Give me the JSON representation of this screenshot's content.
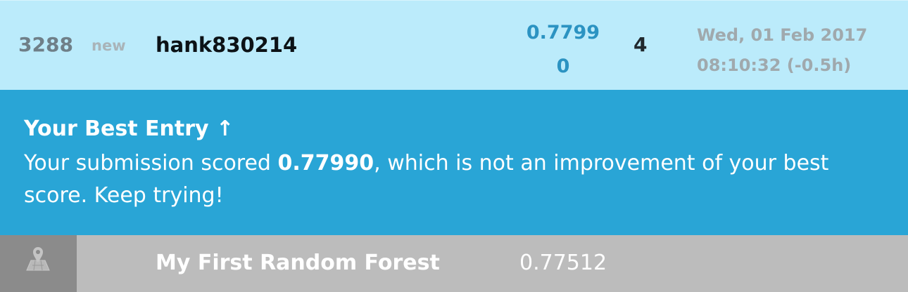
{
  "leaderboard_row": {
    "rank": "3288",
    "delta": "new",
    "team_name": "hank830214",
    "score_line1": "0.7799",
    "score_line2": "0",
    "entries": "4",
    "last_submission_line1": "Wed, 01 Feb 2017",
    "last_submission_line2": "08:10:32 (-0.5h)"
  },
  "best_entry": {
    "title": "Your Best Entry ↑",
    "message_prefix": "Your submission scored ",
    "score": "0.77990",
    "message_suffix": ", which is not an improvement of your best score. Keep trying!"
  },
  "submission_row": {
    "icon": "map-pin-icon",
    "name": "My First Random Forest",
    "score": "0.77512"
  },
  "colors": {
    "leader_row_bg": "#bbebfb",
    "banner_bg": "#29a5d6",
    "submission_row_bg": "#bcbcbc",
    "score_text": "#2b93c2"
  }
}
